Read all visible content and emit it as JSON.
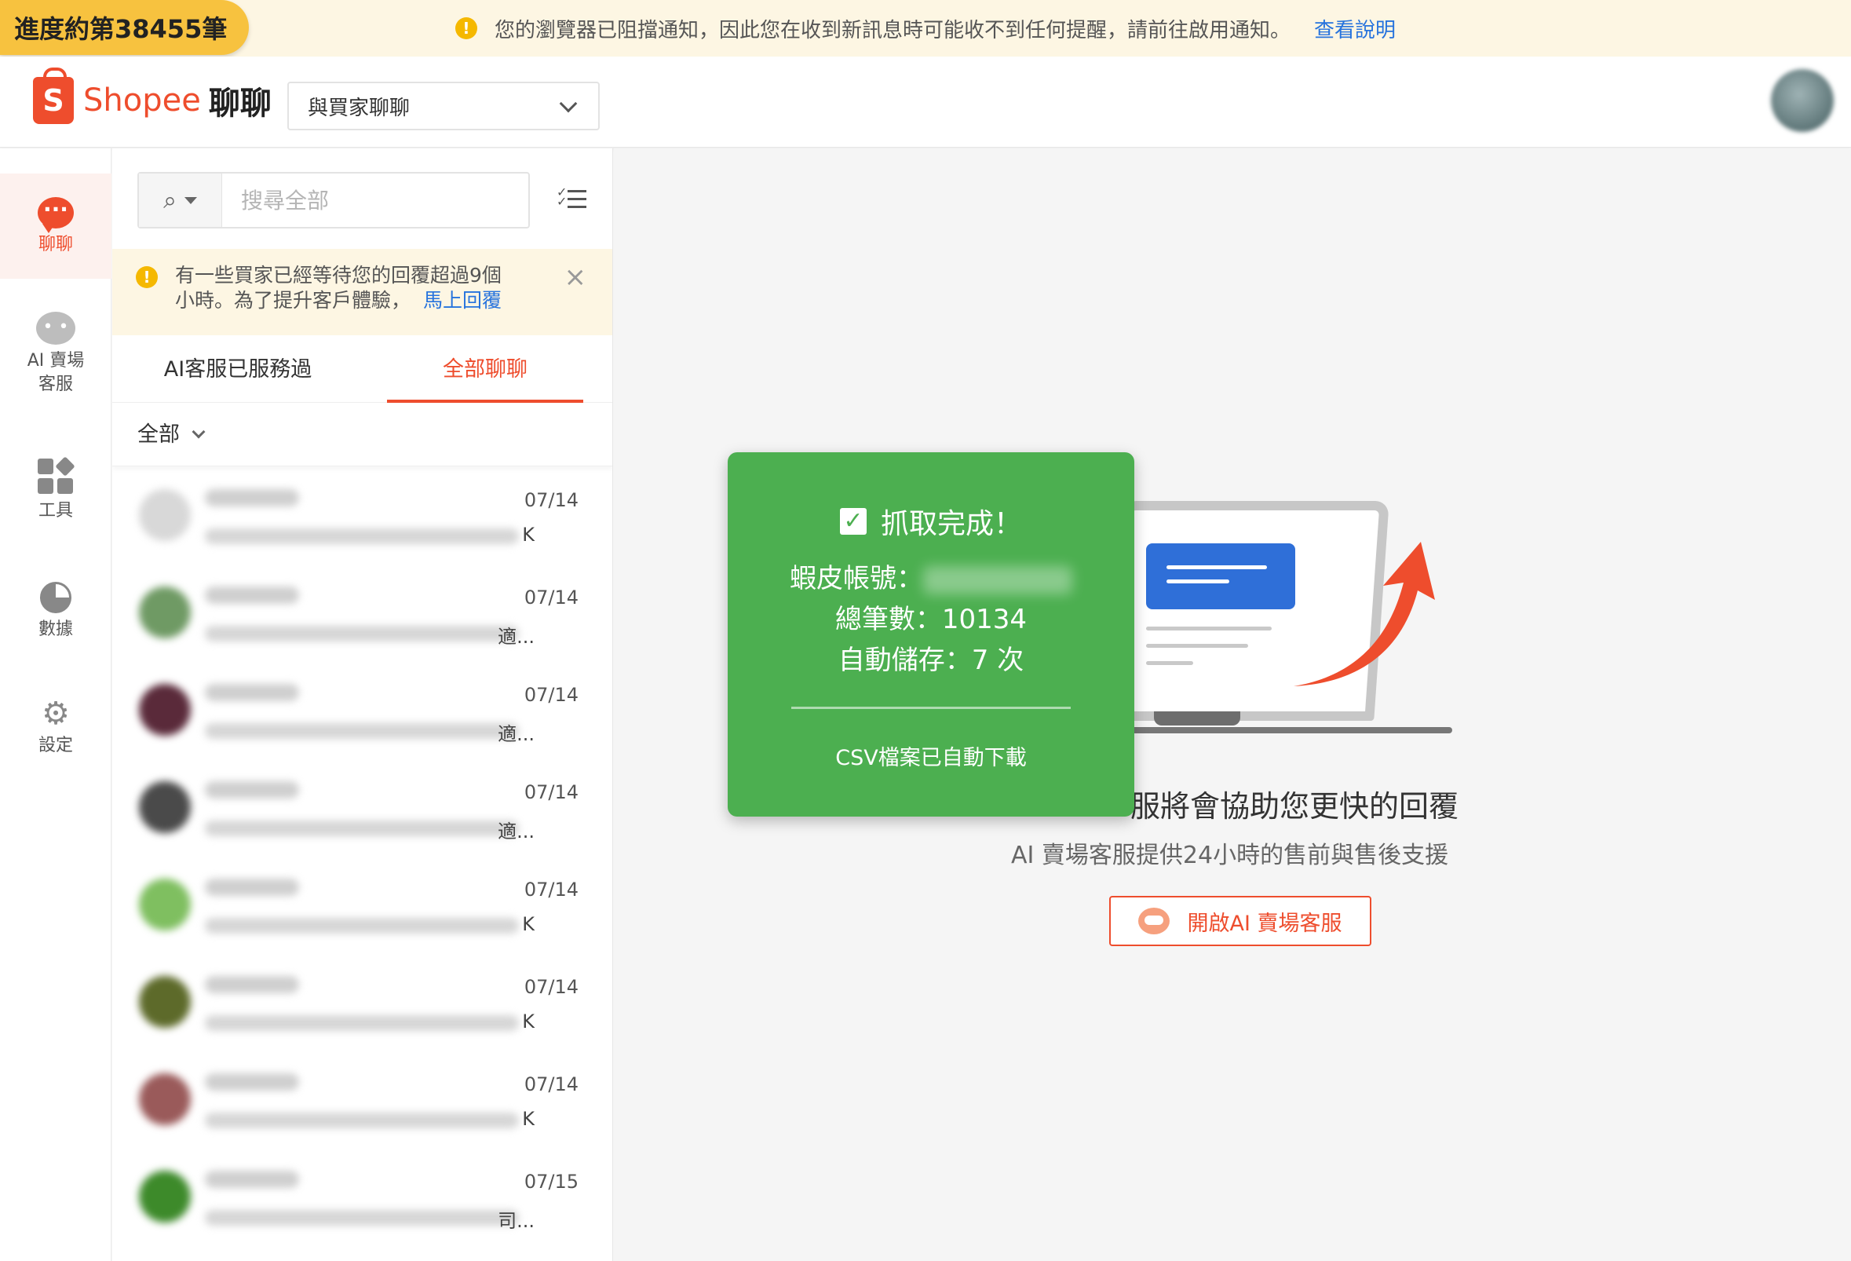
{
  "progress_pill": "進度約第38455筆",
  "notice_bar": {
    "text": "您的瀏覽器已阻擋通知，因此您在收到新訊息時可能收不到任何提醒，請前往啟用通知。",
    "link": "查看說明"
  },
  "header": {
    "brand": "Shopee",
    "brand_suffix": "聊聊",
    "chat_select": "與買家聊聊"
  },
  "nav": [
    {
      "label": "聊聊"
    },
    {
      "label": "AI 賣場",
      "label2": "客服"
    },
    {
      "label": "工具"
    },
    {
      "label": "數據"
    },
    {
      "label": "設定"
    }
  ],
  "search": {
    "placeholder": "搜尋全部"
  },
  "wait_banner": {
    "line1": "有一些買家已經等待您的回覆超過9個",
    "line2": "小時。為了提升客戶體驗，",
    "link": "馬上回覆"
  },
  "tabs": [
    "AI客服已服務過",
    "全部聊聊"
  ],
  "filter": "全部",
  "conversations": [
    {
      "date": "07/14",
      "tail": "K",
      "avatar": "#d8d8d8"
    },
    {
      "date": "07/14",
      "tail": "適...",
      "avatar": "#6f9a64"
    },
    {
      "date": "07/14",
      "tail": "適...",
      "avatar": "#5a2a3a"
    },
    {
      "date": "07/14",
      "tail": "適...",
      "avatar": "#4a4a4a"
    },
    {
      "date": "07/14",
      "tail": "K",
      "avatar": "#7fbf60"
    },
    {
      "date": "07/14",
      "tail": "K",
      "avatar": "#5d6a2a"
    },
    {
      "date": "07/14",
      "tail": "K",
      "avatar": "#9a5a5a"
    },
    {
      "date": "07/15",
      "tail": "司...",
      "avatar": "#3d8a2a"
    }
  ],
  "main": {
    "headline": "服將會協助您更快的回覆",
    "subline": "AI 賣場客服提供24小時的售前與售後支援",
    "button": "開啟AI 賣場客服"
  },
  "toast": {
    "title": "抓取完成！",
    "account_label": "蝦皮帳號：",
    "total_label": "總筆數：",
    "total_value": "10134",
    "autosave_label": "自動儲存：",
    "autosave_value": "7 次",
    "footer": "CSV檔案已自動下載"
  }
}
